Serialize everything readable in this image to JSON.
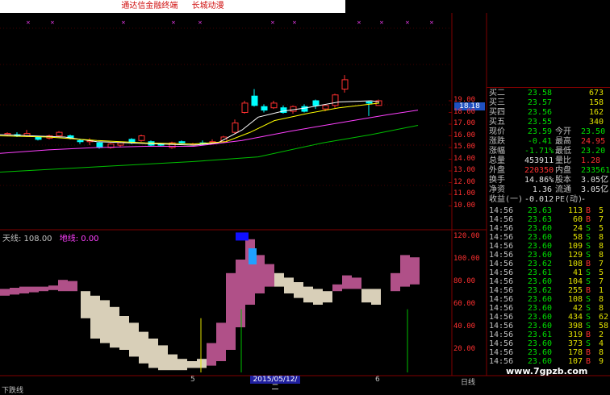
{
  "window": {
    "title": "通达信金融终端",
    "subtitle": "长城动漫"
  },
  "main_axis": {
    "ticks": [
      "19.00",
      "18.00",
      "17.00",
      "16.00",
      "15.00",
      "14.00",
      "13.00",
      "12.00",
      "11.00",
      "10.00"
    ],
    "current_price": "18.18"
  },
  "indicator": {
    "label_a": "天线: 108.00",
    "label_b": "地线: 0.00",
    "ticks": [
      "120.00",
      "100.00",
      "80.00",
      "60.00",
      "40.00",
      "20.00"
    ]
  },
  "x_axis": {
    "labels": [
      "5",
      "6"
    ],
    "cursor_date": "2015/05/12/二",
    "period": "日线"
  },
  "bottom": {
    "tab": "下跌线",
    "watermark": "www.7gpzb.com"
  },
  "quote": {
    "rows": [
      {
        "label": "买二",
        "value": "23.58",
        "extra": "673",
        "color": "green"
      },
      {
        "label": "买三",
        "value": "23.57",
        "extra": "158",
        "color": "green"
      },
      {
        "label": "买四",
        "value": "23.56",
        "extra": "162",
        "color": "green"
      },
      {
        "label": "买五",
        "value": "23.55",
        "extra": "340",
        "color": "green"
      }
    ],
    "stats": [
      {
        "l1": "现价",
        "v1": "23.59",
        "l2": "今开",
        "v2": "23.50",
        "c1": "green",
        "c2": "green"
      },
      {
        "l1": "涨跌",
        "v1": "-0.41",
        "l2": "最高",
        "v2": "24.95",
        "c1": "green",
        "c2": "red"
      },
      {
        "l1": "涨幅",
        "v1": "-1.71%",
        "l2": "最低",
        "v2": "23.20",
        "c1": "green",
        "c2": "green"
      },
      {
        "l1": "总量",
        "v1": "453911",
        "l2": "量比",
        "v2": "1.28",
        "c1": "white",
        "c2": "red"
      },
      {
        "l1": "外盘",
        "v1": "220350",
        "l2": "内盘",
        "v2": "233561",
        "c1": "red",
        "c2": "green"
      },
      {
        "l1": "换手",
        "v1": "14.86%",
        "l2": "股本",
        "v2": "3.05亿",
        "c1": "white",
        "c2": "white"
      },
      {
        "l1": "净资",
        "v1": "1.36",
        "l2": "流通",
        "v2": "3.05亿",
        "c1": "white",
        "c2": "white"
      },
      {
        "l1": "收益(一)",
        "v1": "-0.012",
        "l2": "PE(动)",
        "v2": "-",
        "c1": "white",
        "c2": "white"
      }
    ],
    "ticks": [
      {
        "t": "14:56",
        "p": "23.63",
        "v": "113",
        "s": "B",
        "n": "5"
      },
      {
        "t": "14:56",
        "p": "23.63",
        "v": "60",
        "s": "B",
        "n": "7"
      },
      {
        "t": "14:56",
        "p": "23.60",
        "v": "24",
        "s": "S",
        "n": "5"
      },
      {
        "t": "14:56",
        "p": "23.60",
        "v": "58",
        "s": "S",
        "n": "8"
      },
      {
        "t": "14:56",
        "p": "23.60",
        "v": "109",
        "s": "S",
        "n": "8"
      },
      {
        "t": "14:56",
        "p": "23.60",
        "v": "129",
        "s": "S",
        "n": "8"
      },
      {
        "t": "14:56",
        "p": "23.62",
        "v": "108",
        "s": "B",
        "n": "7"
      },
      {
        "t": "14:56",
        "p": "23.61",
        "v": "41",
        "s": "S",
        "n": "5"
      },
      {
        "t": "14:56",
        "p": "23.60",
        "v": "104",
        "s": "S",
        "n": "7"
      },
      {
        "t": "14:56",
        "p": "23.62",
        "v": "255",
        "s": "B",
        "n": "1"
      },
      {
        "t": "14:56",
        "p": "23.60",
        "v": "108",
        "s": "S",
        "n": "8"
      },
      {
        "t": "14:56",
        "p": "23.60",
        "v": "42",
        "s": "S",
        "n": "8"
      },
      {
        "t": "14:56",
        "p": "23.60",
        "v": "434",
        "s": "S",
        "n": "62"
      },
      {
        "t": "14:56",
        "p": "23.60",
        "v": "398",
        "s": "S",
        "n": "58"
      },
      {
        "t": "14:56",
        "p": "23.61",
        "v": "319",
        "s": "B",
        "n": "2"
      },
      {
        "t": "14:56",
        "p": "23.60",
        "v": "373",
        "s": "S",
        "n": "4"
      },
      {
        "t": "14:56",
        "p": "23.60",
        "v": "178",
        "s": "B",
        "n": "8"
      },
      {
        "t": "14:56",
        "p": "23.60",
        "v": "107",
        "s": "B",
        "n": "9"
      }
    ]
  },
  "colors": {
    "up": "#ff3030",
    "down": "#00ffff",
    "ma5": "#ffffff",
    "ma10": "#ffff00",
    "ma20": "#ff40ff",
    "ma60": "#00c000",
    "ind_up": "#b05088",
    "ind_down": "#d8cfb8"
  }
}
